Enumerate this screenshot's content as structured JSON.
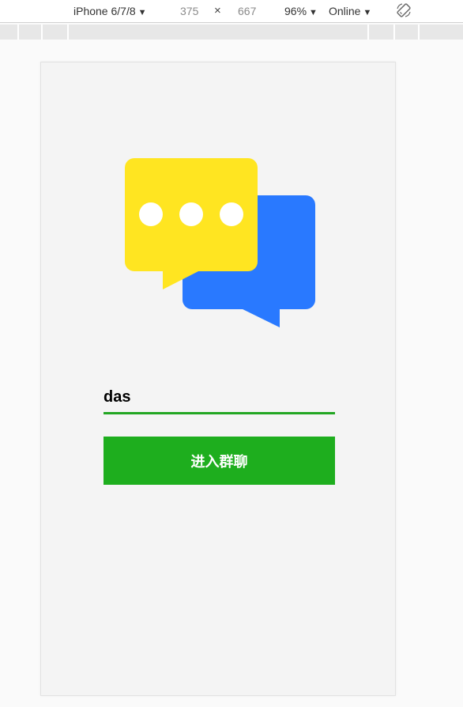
{
  "toolbar": {
    "device": "iPhone 6/7/8",
    "width": "375",
    "times": "×",
    "height": "667",
    "zoom": "96%",
    "network": "Online",
    "caret": "▼",
    "rotate_icon": "rotate-device-icon"
  },
  "app": {
    "logo_icon": "chat-bubbles-icon",
    "colors": {
      "bubble_front": "#ffe521",
      "bubble_back": "#2979ff",
      "accent": "#1eae1e",
      "page_bg": "#f4f4f4"
    },
    "nickname_value": "das",
    "enter_button_label": "进入群聊"
  }
}
